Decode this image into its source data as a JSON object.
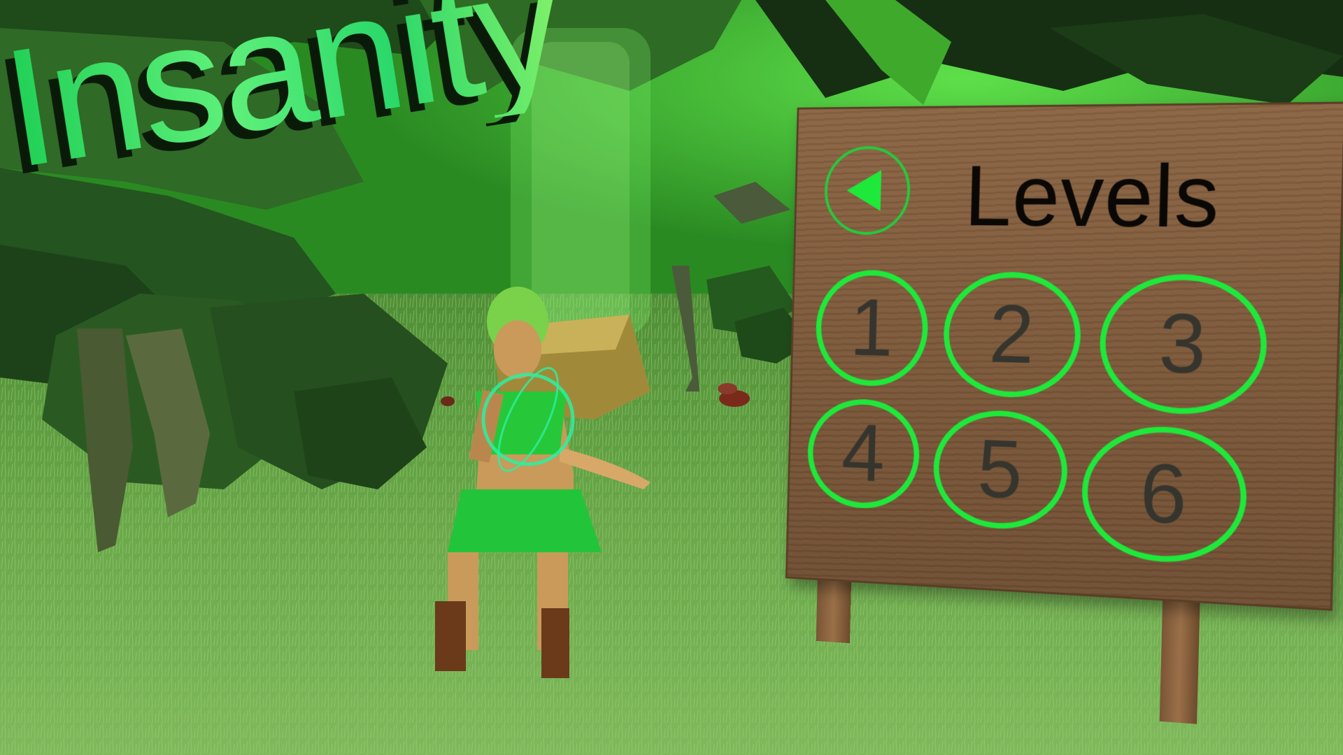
{
  "game": {
    "title": "Insanity"
  },
  "level_select": {
    "heading": "Levels",
    "back_icon": "triangle-left-arrow",
    "levels": [
      "1",
      "2",
      "3",
      "4",
      "5",
      "6"
    ]
  },
  "colors": {
    "accent_green": "#1ee83a",
    "title_green": "#2ad86a",
    "board_wood": "#7c5839",
    "grass": "#6aa84a"
  }
}
